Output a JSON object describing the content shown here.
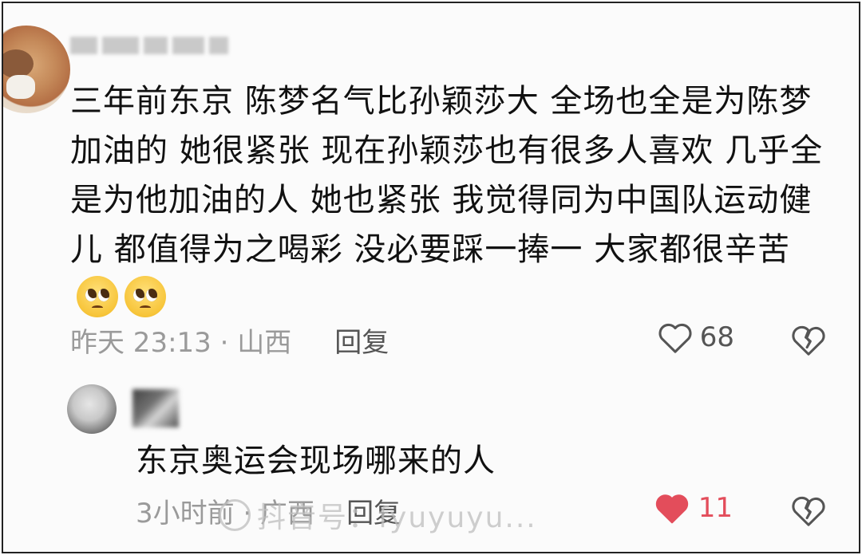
{
  "comment": {
    "text": "三年前东京 陈梦名气比孙颖莎大 全场也全是为陈梦加油的 她很紧张 现在孙颖莎也有很多人喜欢 几乎全是为他加油的人 她也紧张 我觉得同为中国队运动健儿 都值得为之喝彩 没必要踩一捧一 大家都很辛苦",
    "emoji": "pleading-face",
    "time_location": "昨天 23:13 · 山西",
    "reply_label": "回复",
    "like_count": "68"
  },
  "reply": {
    "text": "东京奥运会现场哪来的人",
    "time_location": "3小时前 · 广西",
    "reply_label": "回复",
    "like_count": "11",
    "liked_color": "#e34d5b"
  },
  "watermark": {
    "text": "抖音号：fyuyuyu..."
  }
}
